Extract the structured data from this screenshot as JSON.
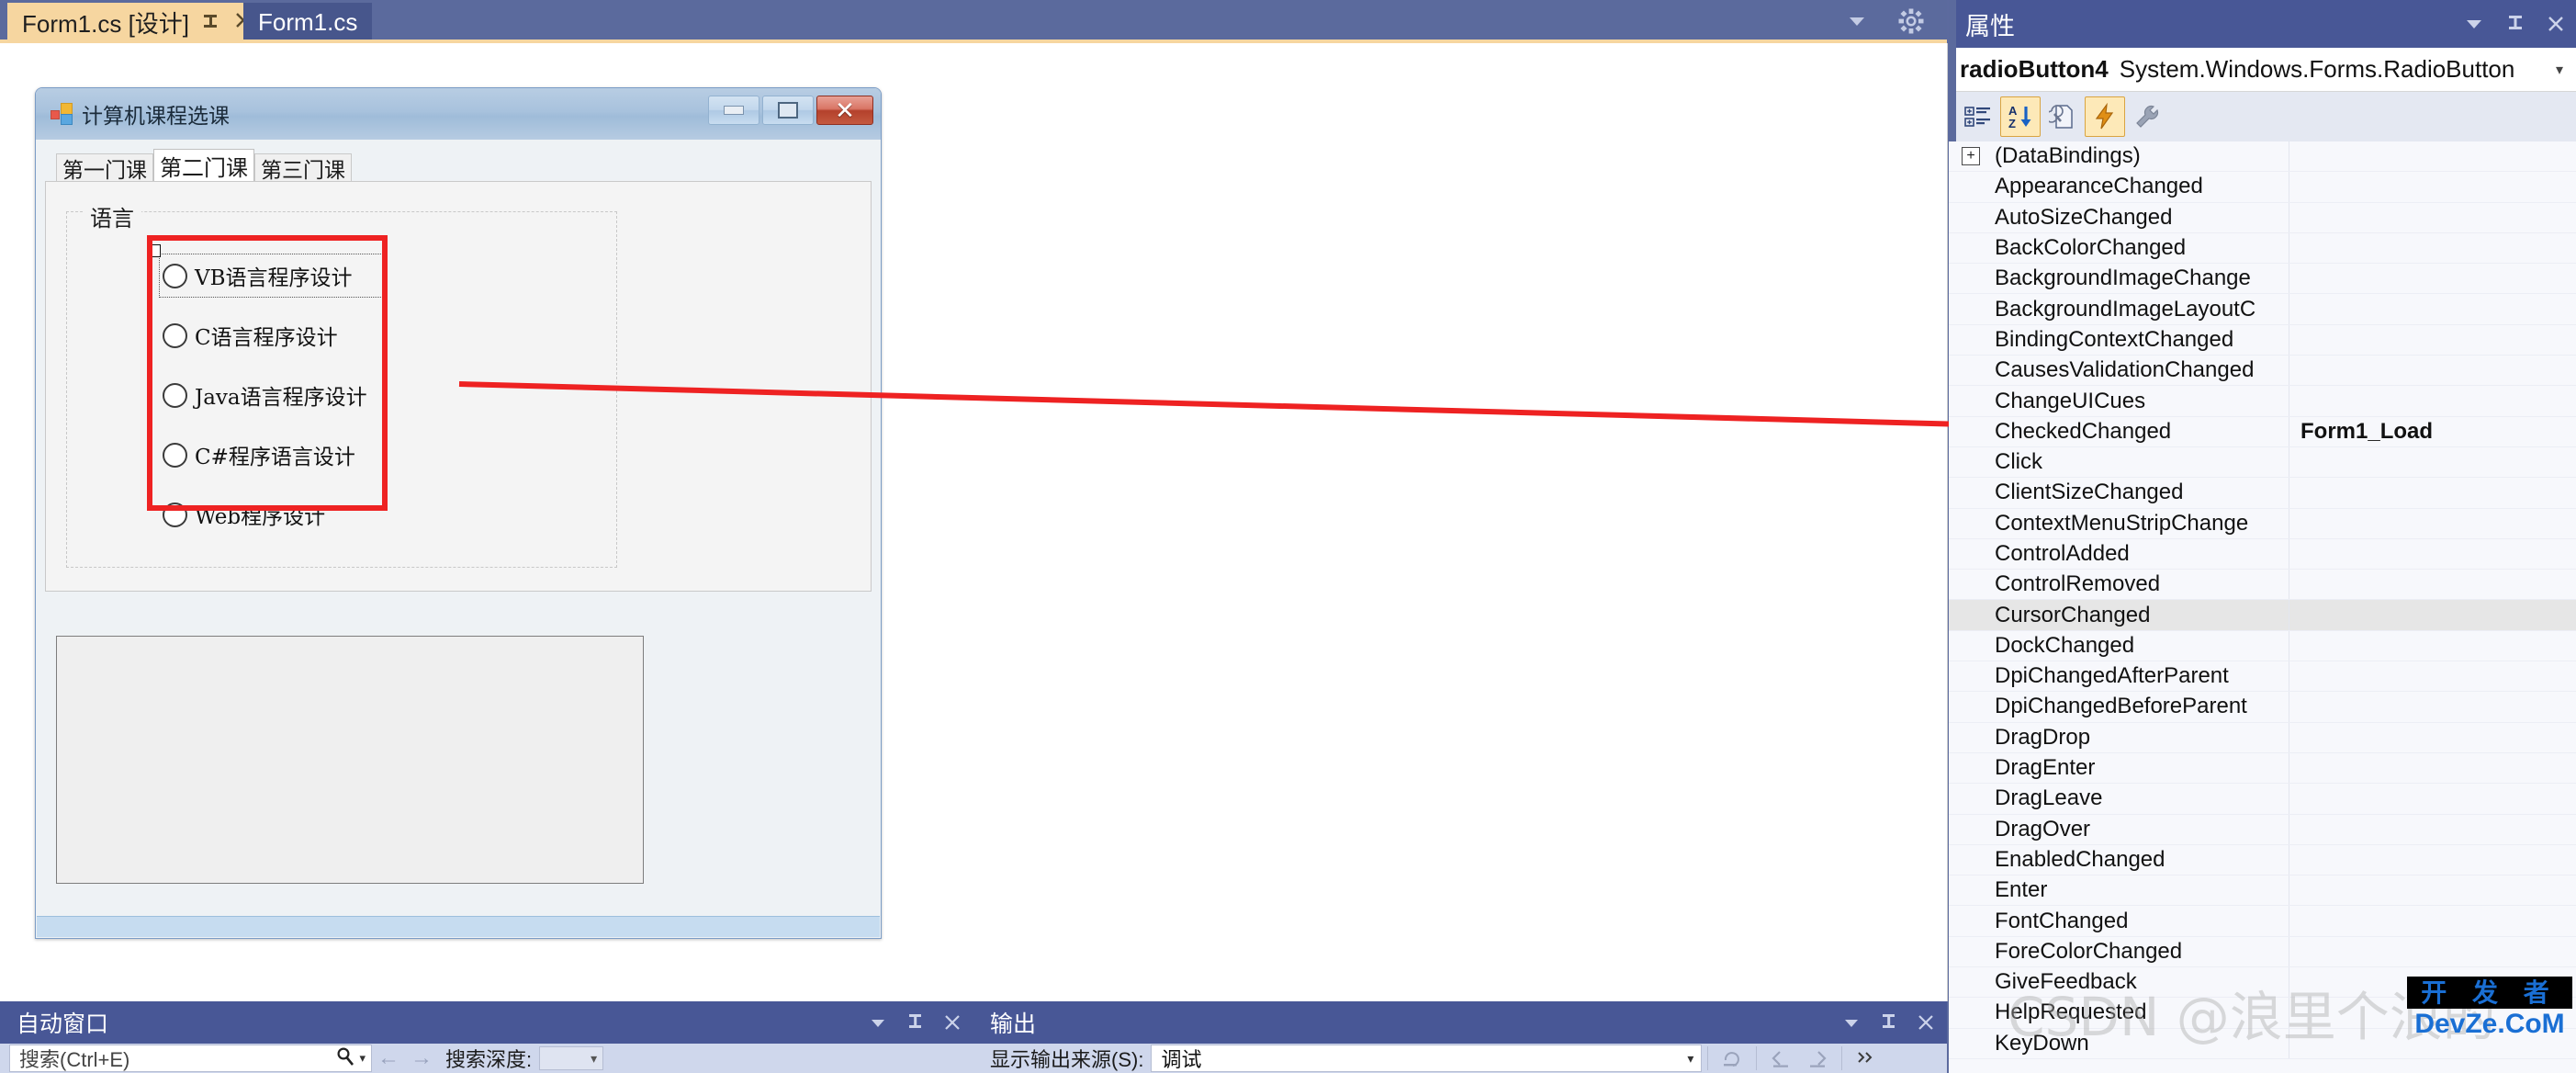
{
  "tabstrip": {
    "tabs": [
      {
        "label": "Form1.cs [设计]",
        "active": true,
        "pin_icon": "pin-icon",
        "close_icon": "close-icon"
      },
      {
        "label": "Form1.cs",
        "active": false
      }
    ],
    "right_icons": [
      "chevron-down-icon",
      "gear-icon"
    ]
  },
  "form": {
    "title": "计算机课程选课",
    "app_icon": "windows-forms-icon",
    "window_buttons": {
      "minimize": "minimize-icon",
      "maximize": "maximize-icon",
      "close": "close-icon"
    },
    "tabs": [
      {
        "label": "第一门课",
        "selected": false
      },
      {
        "label": "第二门课",
        "selected": true
      },
      {
        "label": "第三门课",
        "selected": false
      }
    ],
    "groupbox": {
      "legend": "语言",
      "radios": [
        {
          "label": "VB语言程序设计",
          "selected": true
        },
        {
          "label": "C语言程序设计",
          "selected": false
        },
        {
          "label": "Java语言程序设计",
          "selected": false
        },
        {
          "label": "C#程序语言设计",
          "selected": false
        },
        {
          "label": "Web程序设计",
          "selected": false
        }
      ]
    },
    "annotation_color": "#ee2222"
  },
  "properties": {
    "title": "属性",
    "head_icons": [
      "chevron-down-icon",
      "pin-icon",
      "close-icon"
    ],
    "selected_object": "radioButton4",
    "selected_type": "System.Windows.Forms.RadioButton",
    "dropdown_caret": "▾",
    "toolbar": [
      {
        "name": "categorized-icon",
        "active": false
      },
      {
        "name": "alphabetical-sort-icon",
        "active": true
      },
      {
        "name": "properties-page-icon",
        "active": false
      },
      {
        "name": "events-lightning-icon",
        "active": true
      },
      {
        "name": "property-pages-wrench-icon",
        "active": false
      }
    ],
    "rows": [
      {
        "name": "(DataBindings)",
        "value": "",
        "expander": "+",
        "highlight": false
      },
      {
        "name": "AppearanceChanged",
        "value": "",
        "highlight": false
      },
      {
        "name": "AutoSizeChanged",
        "value": "",
        "highlight": false
      },
      {
        "name": "BackColorChanged",
        "value": "",
        "highlight": false
      },
      {
        "name": "BackgroundImageChange",
        "value": "",
        "highlight": false
      },
      {
        "name": "BackgroundImageLayoutC",
        "value": "",
        "highlight": false
      },
      {
        "name": "BindingContextChanged",
        "value": "",
        "highlight": false
      },
      {
        "name": "CausesValidationChanged",
        "value": "",
        "highlight": false
      },
      {
        "name": "ChangeUICues",
        "value": "",
        "highlight": false
      },
      {
        "name": "CheckedChanged",
        "value": "Form1_Load",
        "highlight": false
      },
      {
        "name": "Click",
        "value": "",
        "highlight": false
      },
      {
        "name": "ClientSizeChanged",
        "value": "",
        "highlight": false
      },
      {
        "name": "ContextMenuStripChange",
        "value": "",
        "highlight": false
      },
      {
        "name": "ControlAdded",
        "value": "",
        "highlight": false
      },
      {
        "name": "ControlRemoved",
        "value": "",
        "highlight": false
      },
      {
        "name": "CursorChanged",
        "value": "",
        "highlight": true
      },
      {
        "name": "DockChanged",
        "value": "",
        "highlight": false
      },
      {
        "name": "DpiChangedAfterParent",
        "value": "",
        "highlight": false
      },
      {
        "name": "DpiChangedBeforeParent",
        "value": "",
        "highlight": false
      },
      {
        "name": "DragDrop",
        "value": "",
        "highlight": false
      },
      {
        "name": "DragEnter",
        "value": "",
        "highlight": false
      },
      {
        "name": "DragLeave",
        "value": "",
        "highlight": false
      },
      {
        "name": "DragOver",
        "value": "",
        "highlight": false
      },
      {
        "name": "EnabledChanged",
        "value": "",
        "highlight": false
      },
      {
        "name": "Enter",
        "value": "",
        "highlight": false
      },
      {
        "name": "FontChanged",
        "value": "",
        "highlight": false
      },
      {
        "name": "ForeColorChanged",
        "value": "",
        "highlight": false
      },
      {
        "name": "GiveFeedback",
        "value": "",
        "highlight": false
      },
      {
        "name": "HelpRequested",
        "value": "",
        "highlight": false
      },
      {
        "name": "KeyDown",
        "value": "",
        "highlight": false
      }
    ]
  },
  "autos_panel": {
    "title": "自动窗口",
    "head_icons": [
      "chevron-down-icon",
      "pin-icon",
      "close-icon"
    ],
    "search_placeholder": "搜索(Ctrl+E)",
    "search_icon": "search-icon",
    "search_caret": "▾",
    "back_icon": "←",
    "forward_icon": "→",
    "depth_label": "搜索深度:",
    "depth_value": "",
    "depth_caret": "▾"
  },
  "output_panel": {
    "title": "输出",
    "head_icons": [
      "chevron-down-icon",
      "pin-icon",
      "close-icon"
    ],
    "source_label": "显示输出来源(S):",
    "source_value": "调试",
    "source_caret": "▾",
    "tool_icons": [
      "clear-output-icon",
      "back-icon",
      "forward-icon",
      "overflow-icon"
    ]
  },
  "watermarks": {
    "csdn": "CSDN @浪里个浪的",
    "dev_top": "开 发 者",
    "dev_bottom": "DevZe.CoM"
  },
  "colors": {
    "vs_chrome": "#485796",
    "active_tab": "#f6d6a0",
    "annotation_red": "#ee2222"
  }
}
